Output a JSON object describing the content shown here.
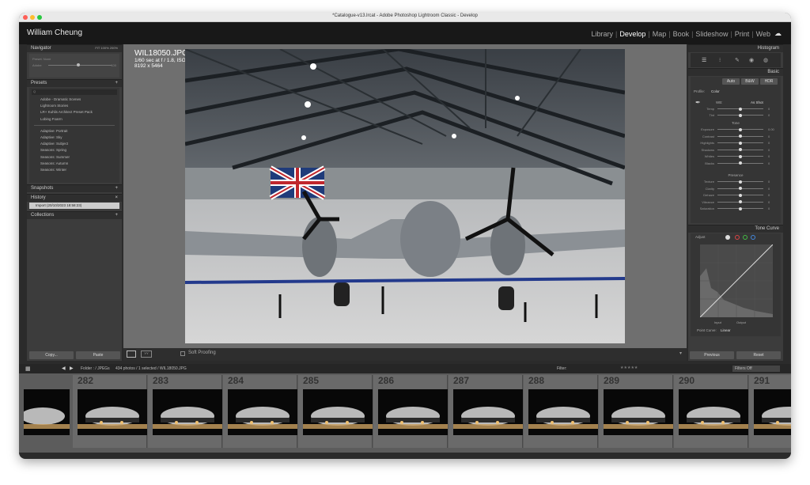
{
  "window": {
    "title": "*Catalogue-v13.lrcat - Adobe Photoshop Lightroom Classic - Develop"
  },
  "identity": {
    "name": "William Cheung"
  },
  "modules": [
    "Library",
    "Develop",
    "Map",
    "Book",
    "Slideshow",
    "Print",
    "Web"
  ],
  "active_module": "Develop",
  "left": {
    "navigator": {
      "title": "Navigator",
      "zoom": [
        "FIT",
        "100%",
        "200%"
      ],
      "preset_label": "Preset: None",
      "author": "Adobe",
      "n3": "100"
    },
    "presets": {
      "title": "Presets",
      "search": "Q",
      "items": [
        "Adobe - Dramatic Scenes",
        "Lightroom Stories",
        "LR+ Kuhlis Architect Preset Pack",
        "Lobing Foarm"
      ],
      "items2": [
        "Adaptive: Portrait",
        "Adaptive: Sky",
        "Adaptive: Subject",
        "Seasons: Spring",
        "Seasons: Summer",
        "Seasons: Autumn",
        "Seasons: Winter"
      ]
    },
    "snapshots": {
      "title": "Snapshots"
    },
    "history": {
      "title": "History",
      "item": "Import (20/10/2023 18:58:23)"
    },
    "collections": {
      "title": "Collections"
    },
    "copy": "Copy...",
    "paste": "Paste"
  },
  "photo_info": {
    "filename": "WIL18050.JPG",
    "exposure": "1/60 sec at f / 1.8, ISO 1600",
    "dimensions": "8192 x 5464"
  },
  "toolbar": {
    "soft_proofing": "Soft Proofing"
  },
  "right": {
    "histogram": {
      "title": "Histogram"
    },
    "basic": {
      "title": "Basic",
      "buttons": [
        "Auto",
        "B&W",
        "HDR"
      ],
      "profile_label": "Profile:",
      "profile": "Color",
      "wb_label": "WB:",
      "wb": "As Shot",
      "wb_sliders": [
        {
          "l": "Temp",
          "v": "0"
        },
        {
          "l": "Tint",
          "v": "0"
        }
      ],
      "tone": "Tone",
      "tone_sliders": [
        {
          "l": "Exposure",
          "v": "0.00"
        },
        {
          "l": "Contrast",
          "v": "0"
        },
        {
          "l": "Highlights",
          "v": "0"
        },
        {
          "l": "Shadows",
          "v": "0"
        },
        {
          "l": "Whites",
          "v": "0"
        },
        {
          "l": "Blacks",
          "v": "0"
        }
      ],
      "presence": "Presence",
      "presence_sliders": [
        {
          "l": "Texture",
          "v": "0"
        },
        {
          "l": "Clarity",
          "v": "0"
        },
        {
          "l": "Dehaze",
          "v": "0"
        },
        {
          "l": "Vibrance",
          "v": "0"
        },
        {
          "l": "Saturation",
          "v": "0"
        }
      ]
    },
    "tone_curve": {
      "title": "Tone Curve",
      "adjust": "Adjust",
      "input": "Input",
      "output": "Output",
      "point_curve": "Point Curve:",
      "point_curve_value": "Linear"
    },
    "previous": "Previous",
    "reset": "Reset"
  },
  "filmstrip": {
    "folder": "Folder : / JPEGs",
    "count": "434 photos / 1 selected / WIL18050.JPG",
    "filter": "Filter:",
    "filters_off": "Filters Off",
    "frames": [
      "282",
      "283",
      "284",
      "285",
      "286",
      "287",
      "288",
      "289",
      "290",
      "291"
    ]
  }
}
